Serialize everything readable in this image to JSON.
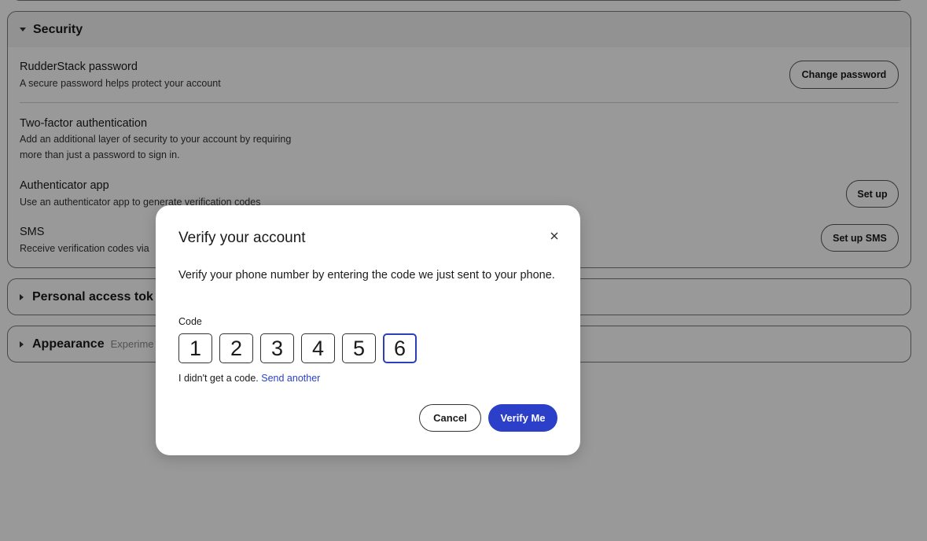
{
  "security": {
    "title": "Security",
    "password": {
      "title": "RudderStack password",
      "desc": "A secure password helps protect your account",
      "button": "Change password"
    },
    "two_factor": {
      "title": "Two-factor authentication",
      "desc_line1": "Add an additional layer of security to your account by requiring",
      "desc_line2": "more than just a password to sign in."
    },
    "authenticator": {
      "title": "Authenticator app",
      "desc": "Use an authenticator app to generate verification codes",
      "button": "Set up"
    },
    "sms": {
      "title": "SMS",
      "desc": "Receive verification codes via",
      "button": "Set up SMS"
    }
  },
  "personal_tokens": {
    "title": "Personal access tok"
  },
  "appearance": {
    "title": "Appearance",
    "tag": "Experime"
  },
  "modal": {
    "title": "Verify your account",
    "close_icon": "close-icon",
    "body": "Verify your phone number by entering the code we just sent to your phone.",
    "code_label": "Code",
    "code_digits": [
      "1",
      "2",
      "3",
      "4",
      "5",
      "6"
    ],
    "resend_text": "I didn't get a code.",
    "resend_link": "Send another",
    "cancel_label": "Cancel",
    "verify_label": "Verify Me"
  },
  "colors": {
    "accent": "#2b3fc8",
    "overlay": "rgba(0,0,0,0.40)"
  }
}
